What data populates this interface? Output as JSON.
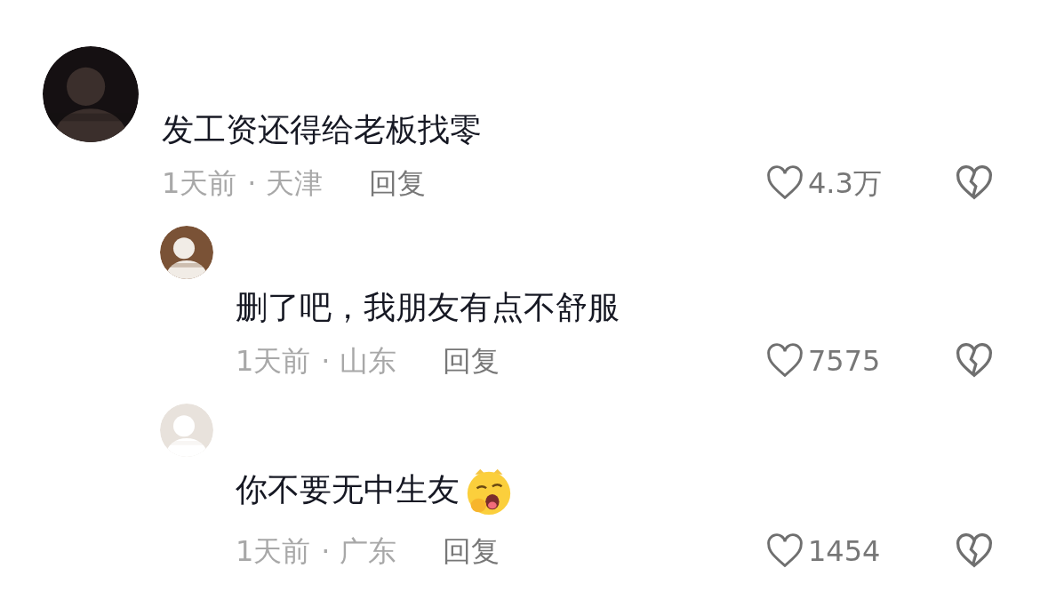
{
  "comments": [
    {
      "text": "发工资还得给老板找零",
      "time": "1天前",
      "location": "· 天津",
      "reply_label": "回复",
      "likes": "4.3万",
      "children": [
        {
          "text": "删了吧，我朋友有点不舒服",
          "time": "1天前",
          "location": "· 山东",
          "reply_label": "回复",
          "likes": "7575"
        },
        {
          "text": "你不要无中生友",
          "emoji": {
            "kind": "yawn"
          },
          "time": "1天前",
          "location": "· 广东",
          "reply_label": "回复",
          "likes": "1454"
        }
      ]
    }
  ]
}
